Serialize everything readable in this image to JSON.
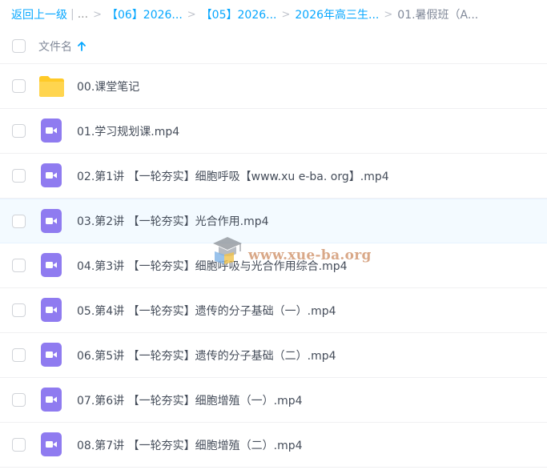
{
  "breadcrumb": {
    "back_label": "返回上一级",
    "ellipsis": "...",
    "crumbs": [
      {
        "label": "【06】2026..."
      },
      {
        "label": "【05】2026..."
      },
      {
        "label": "2026年高三生..."
      }
    ],
    "current": "01.暑假班（A..."
  },
  "header": {
    "name_column": "文件名",
    "sort_direction": "ascending"
  },
  "files": [
    {
      "name": "00.课堂笔记",
      "type": "folder"
    },
    {
      "name": "01.学习规划课.mp4",
      "type": "video"
    },
    {
      "name": "02.第1讲 【一轮夯实】细胞呼吸【www.xu e-ba. org】.mp4",
      "type": "video"
    },
    {
      "name": "03.第2讲 【一轮夯实】光合作用.mp4",
      "type": "video"
    },
    {
      "name": "04.第3讲 【一轮夯实】细胞呼吸与光合作用综合.mp4",
      "type": "video"
    },
    {
      "name": "05.第4讲 【一轮夯实】遗传的分子基础（一）.mp4",
      "type": "video"
    },
    {
      "name": "06.第5讲 【一轮夯实】遗传的分子基础（二）.mp4",
      "type": "video"
    },
    {
      "name": "07.第6讲 【一轮夯实】细胞增殖（一）.mp4",
      "type": "video"
    },
    {
      "name": "08.第7讲 【一轮夯实】细胞增殖（二）.mp4",
      "type": "video"
    }
  ],
  "watermark": {
    "text": "www.xue-ba.org"
  },
  "colors": {
    "link": "#06a7ff",
    "folder": "#ffd24c",
    "video": "#8f7bf0",
    "hover_row": "#f3faff"
  }
}
